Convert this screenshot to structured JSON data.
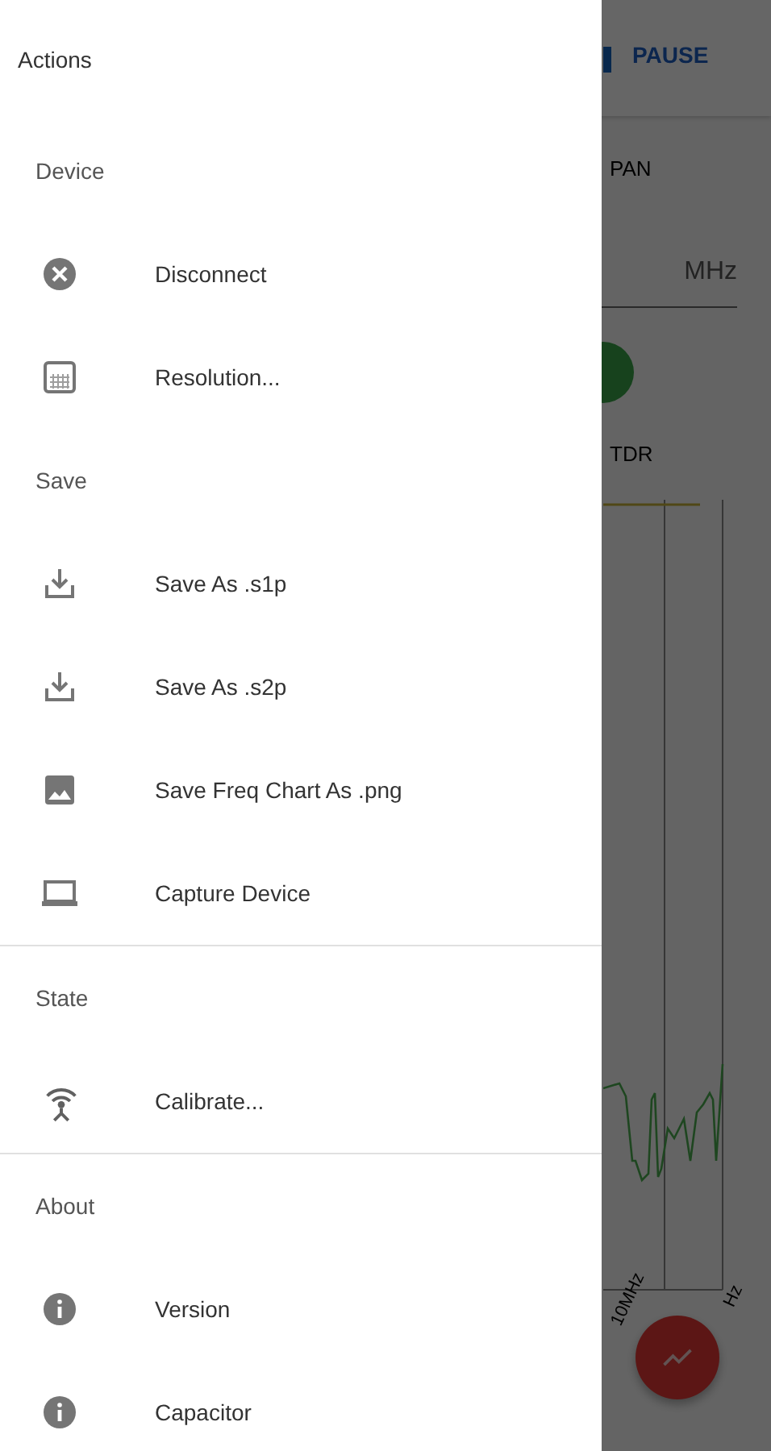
{
  "background_app": {
    "pause_button": "PAUSE",
    "span_label": "PAN",
    "frequency_unit": "MHz",
    "mode_label": "TDR",
    "axis_labels": [
      "10MHz",
      "Hz"
    ]
  },
  "drawer": {
    "title": "Actions",
    "sections": [
      {
        "title": "Device",
        "divider": false,
        "items": [
          {
            "label": "Disconnect",
            "kind": "cancel"
          },
          {
            "label": "Resolution...",
            "kind": "grid"
          }
        ]
      },
      {
        "title": "Save",
        "divider": false,
        "items": [
          {
            "label": "Save As .s1p",
            "kind": "download"
          },
          {
            "label": "Save As .s2p",
            "kind": "download"
          },
          {
            "label": "Save Freq Chart As .png",
            "kind": "image"
          },
          {
            "label": "Capture Device",
            "kind": "laptop"
          }
        ]
      },
      {
        "title": "State",
        "divider": true,
        "items": [
          {
            "label": "Calibrate...",
            "kind": "antenna"
          }
        ]
      },
      {
        "title": "About",
        "divider": true,
        "items": [
          {
            "label": "Version",
            "kind": "info"
          },
          {
            "label": "Capacitor",
            "kind": "info"
          }
        ]
      }
    ]
  }
}
